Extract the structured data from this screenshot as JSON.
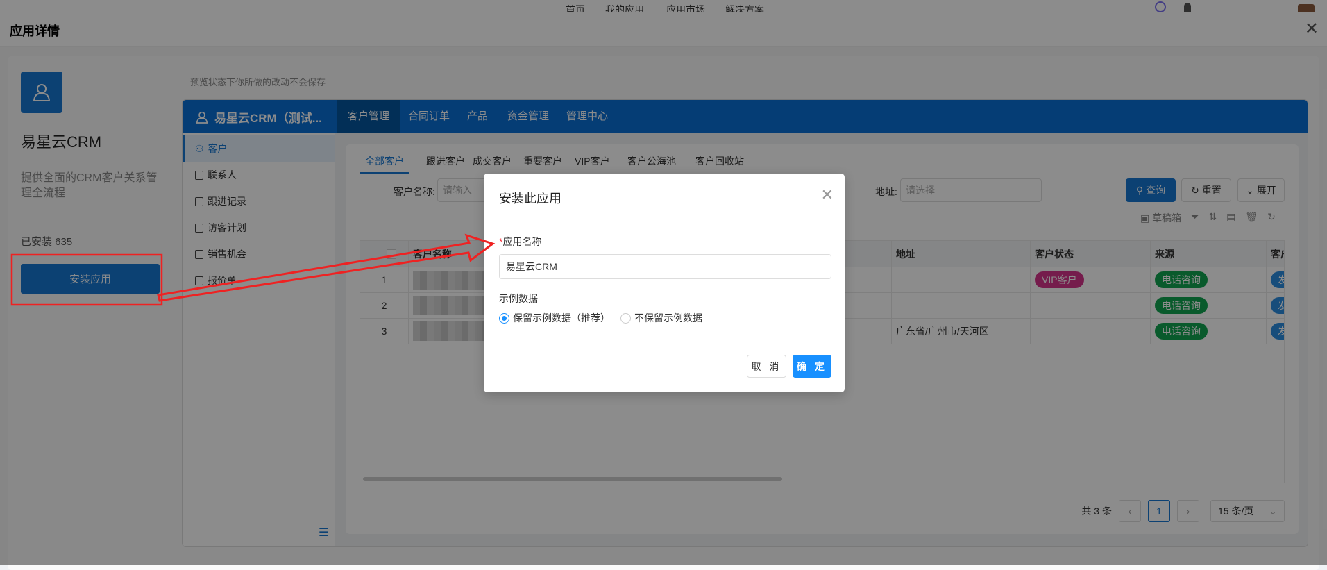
{
  "topnav": {
    "items": [
      "首页",
      "我的应用",
      "应用市场",
      "解决方案"
    ]
  },
  "panel": {
    "title": "应用详情"
  },
  "app": {
    "name": "易星云CRM",
    "description": "提供全面的CRM客户关系管理全流程",
    "installed": "已安装 635",
    "install_button": "安装应用",
    "preview_note": "预览状态下你所做的改动不会保存"
  },
  "crm": {
    "title": "易星云CRM（测试...",
    "menu": [
      "客户管理",
      "合同订单",
      "产品",
      "资金管理",
      "管理中心"
    ],
    "sidebar": [
      "客户",
      "联系人",
      "跟进记录",
      "访客计划",
      "销售机会",
      "报价单"
    ],
    "tabs": [
      "全部客户",
      "跟进客户",
      "成交客户",
      "重要客户",
      "VIP客户",
      "客户公海池",
      "客户回收站"
    ],
    "filters": {
      "name_label": "客户名称:",
      "name_placeholder": "请输入",
      "address_label": "地址:",
      "address_placeholder": "请选择",
      "search": "查询",
      "reset": "重置",
      "expand": "展开"
    },
    "toolbar": {
      "drafts": "草稿箱"
    },
    "table": {
      "headers": [
        "客户名称",
        "地址",
        "客户状态",
        "来源",
        "客户"
      ],
      "rows": [
        {
          "index": "1",
          "address": "",
          "status": "VIP客户",
          "source": "电话咨询",
          "type": "发"
        },
        {
          "index": "2",
          "address": "",
          "status": "",
          "source": "电话咨询",
          "type": "发"
        },
        {
          "index": "3",
          "address": "广东省/广州市/天河区",
          "status": "",
          "source": "电话咨询",
          "type": "发"
        }
      ]
    },
    "pagination": {
      "total": "共 3 条",
      "current": "1",
      "page_size": "15 条/页"
    }
  },
  "modal": {
    "title": "安装此应用",
    "name_label": "应用名称",
    "name_value": "易星云CRM",
    "sample_label": "示例数据",
    "option_keep": "保留示例数据（推荐）",
    "option_discard": "不保留示例数据",
    "selected": "keep",
    "cancel": "取 消",
    "ok": "确 定"
  },
  "colors": {
    "primary": "#1677d2",
    "vip": "#d6338a",
    "source": "#12a550",
    "accent": "#1890ff",
    "annotation": "#ee2222"
  }
}
